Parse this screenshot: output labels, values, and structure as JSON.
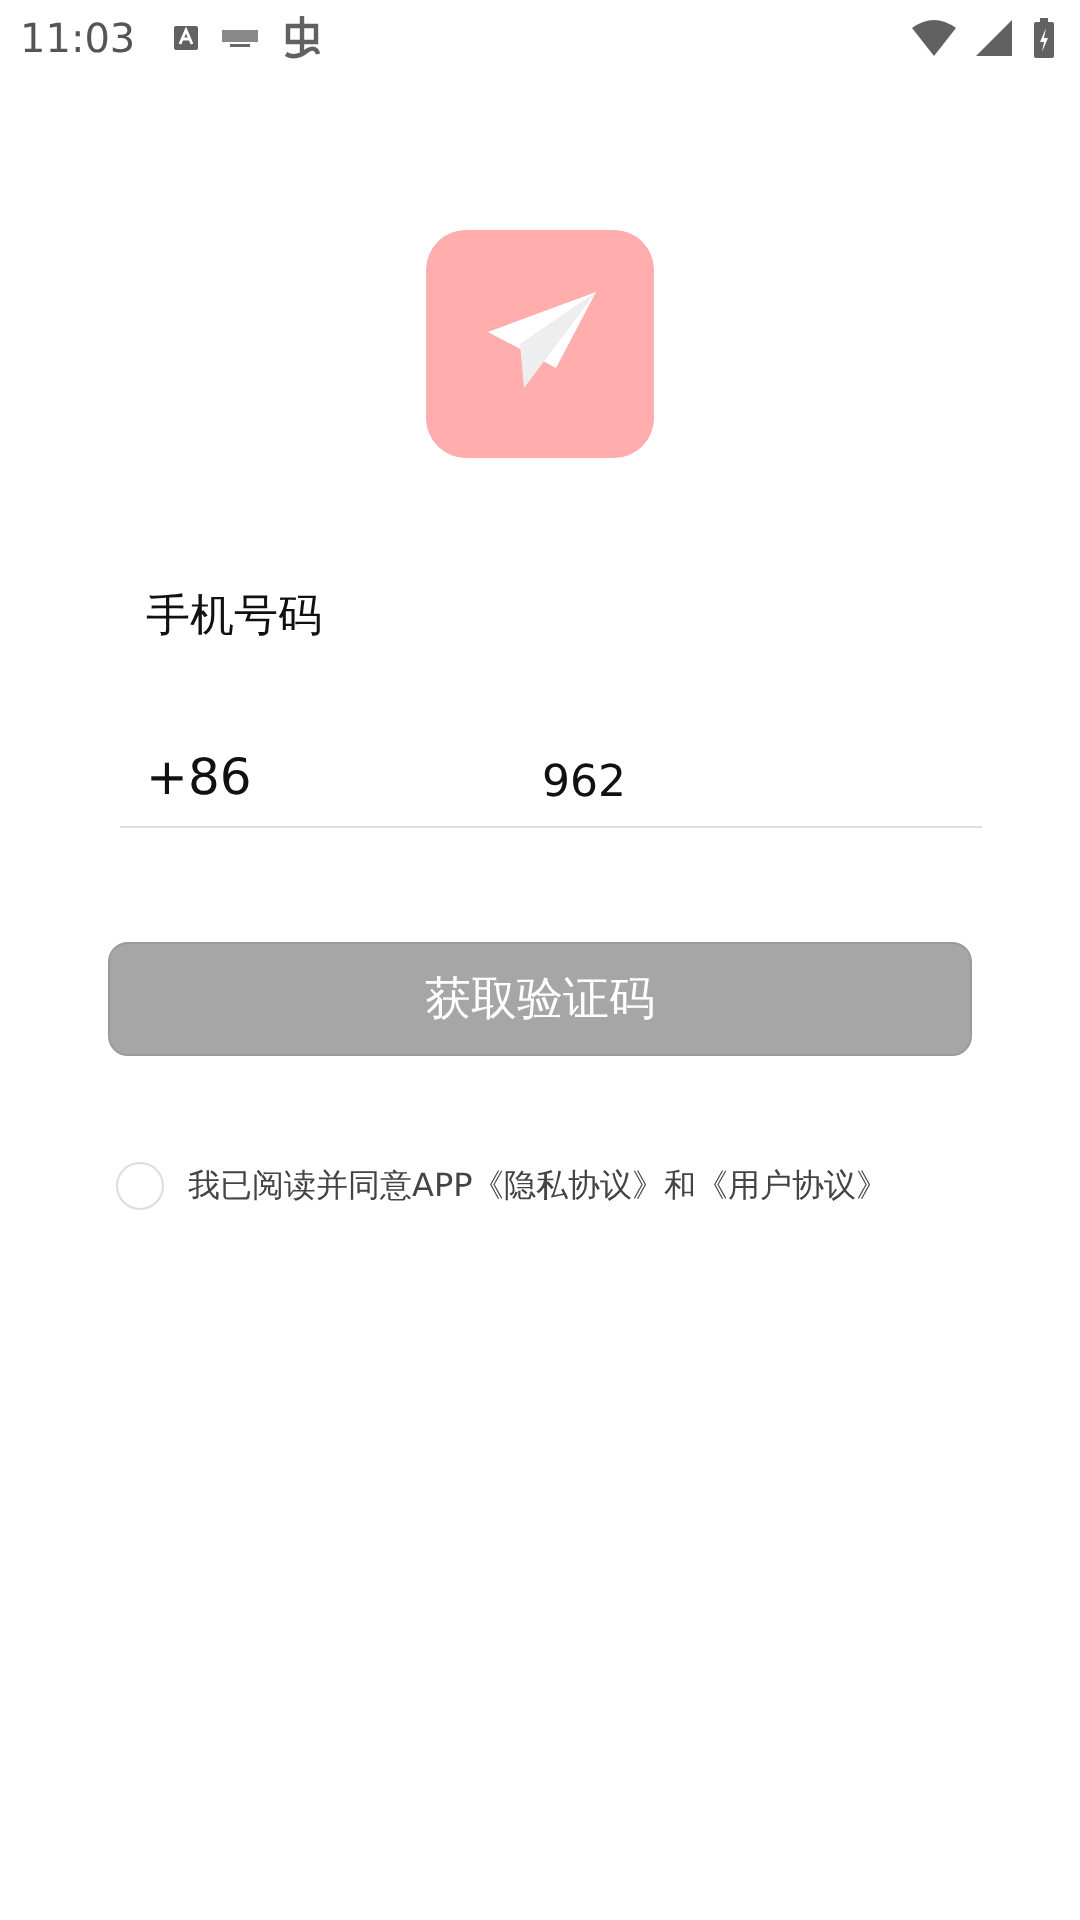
{
  "status_bar": {
    "time": "11:03"
  },
  "phone_label": "手机号码",
  "phone": {
    "country_code": "+86",
    "value": "962"
  },
  "submit_button": {
    "label": "获取验证码",
    "disabled": true
  },
  "agreement": {
    "checked": false,
    "text": "我已阅读并同意APP《隐私协议》和《用户协议》"
  }
}
